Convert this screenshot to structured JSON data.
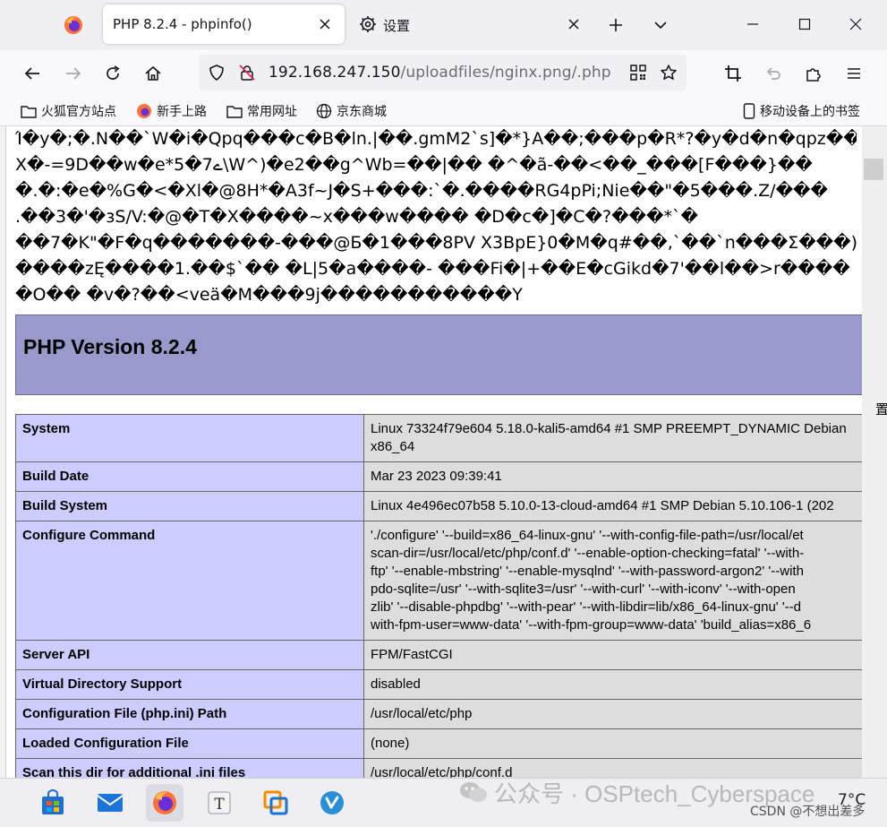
{
  "browser": {
    "tabs": [
      {
        "title": "PHP 8.2.4 - phpinfo()"
      },
      {
        "title": "设置"
      }
    ],
    "url": {
      "host": "192.168.247.150",
      "path": "/uploadfiles/nginx.png/.php"
    },
    "bookmarks": [
      {
        "label": "火狐官方站点",
        "icon": "folder-icon"
      },
      {
        "label": "新手上路",
        "icon": "firefox-icon"
      },
      {
        "label": "常用网址",
        "icon": "folder-icon"
      },
      {
        "label": "京东商城",
        "icon": "globe-icon"
      },
      {
        "label": "移动设备上的书签",
        "icon": "mobile-icon"
      }
    ]
  },
  "page": {
    "garbage_lines": [
      "Ί�y�;�.N��`W�i�Qpq���c�B�ln.|��.gmM2`s]�*}A��;���p�R*?�y�d�n�qpz���",
      "X�-=9D��w�e*5�7ے\\W^)�e2��g^Wb=��|�� �^�ã-��<��_���[F���}��",
      "�.�:�e�%G�<�Xl�@8H*�A3f~J�S+���:`�.����RG4pPi;Nie��\"�5���.Z/���",
      ".��3�'�зS/V:�@�T�X����~x���w���� �D�c�]�C�?���*`�",
      "��7�K\"�F�q�������-���@Ƃ�1���8PV X3BpE}0�M�q#��,`��`n���Σ���)",
      "����zĘ����1.��$`�� �L|5�a����- ���Fi�|+��E�cGikd�7'��l��>r����",
      "�O�� �v�?��<veä�M���9j�����������Y"
    ],
    "version_title": "PHP Version 8.2.4",
    "info_rows": [
      {
        "key": "System",
        "value": [
          "Linux 73324f79e604 5.18.0-kali5-amd64 #1 SMP PREEMPT_DYNAMIC Debian",
          "x86_64"
        ]
      },
      {
        "key": "Build Date",
        "value": [
          "Mar 23 2023 09:39:41"
        ]
      },
      {
        "key": "Build System",
        "value": [
          "Linux 4e496ec07b58 5.10.0-13-cloud-amd64 #1 SMP Debian 5.10.106-1 (202"
        ]
      },
      {
        "key": "Configure Command",
        "value": [
          "'./configure' '--build=x86_64-linux-gnu' '--with-config-file-path=/usr/local/et",
          "scan-dir=/usr/local/etc/php/conf.d' '--enable-option-checking=fatal' '--with-",
          "ftp' '--enable-mbstring' '--enable-mysqlnd' '--with-password-argon2' '--with",
          "pdo-sqlite=/usr' '--with-sqlite3=/usr' '--with-curl' '--with-iconv' '--with-open",
          "zlib' '--disable-phpdbg' '--with-pear' '--with-libdir=lib/x86_64-linux-gnu' '--d",
          "with-fpm-user=www-data' '--with-fpm-group=www-data' 'build_alias=x86_6"
        ]
      },
      {
        "key": "Server API",
        "value": [
          "FPM/FastCGI"
        ]
      },
      {
        "key": "Virtual Directory Support",
        "value": [
          "disabled"
        ]
      },
      {
        "key": "Configuration File (php.ini) Path",
        "value": [
          "/usr/local/etc/php"
        ]
      },
      {
        "key": "Loaded Configuration File",
        "value": [
          "(none)"
        ]
      },
      {
        "key": "Scan this dir for additional .ini files",
        "value": [
          "/usr/local/etc/php/conf.d"
        ]
      }
    ],
    "edge_char": "置"
  },
  "taskbar": {
    "watermark": "公众号 · OSPtech_Cyberspace",
    "csdn": "CSDN @不想出差多",
    "temperature": "7°C",
    "apps": [
      "store-icon",
      "mail-icon",
      "firefox-icon",
      "typora-icon",
      "vmware-icon",
      "vscode-icon"
    ]
  },
  "colors": {
    "php_header": "#9999cc",
    "key_cell": "#ccccff",
    "value_cell": "#dddddd"
  }
}
